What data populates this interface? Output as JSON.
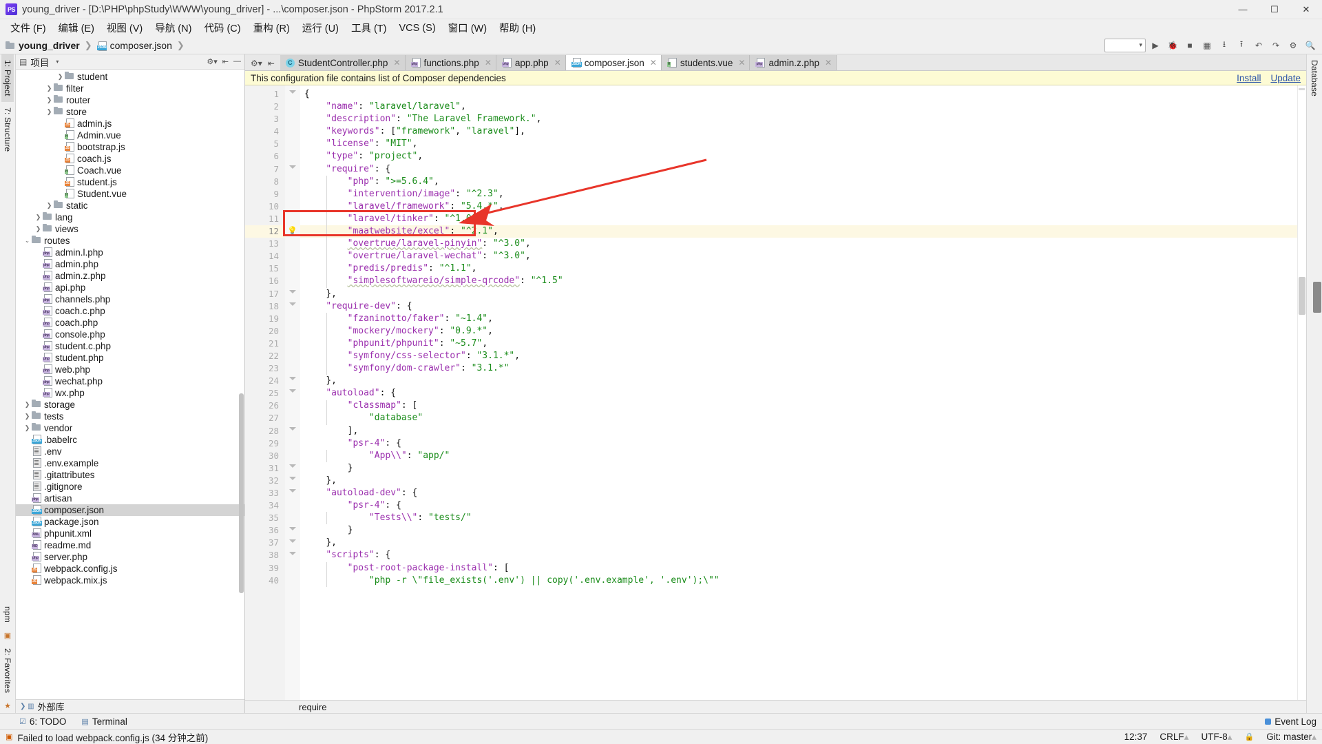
{
  "window": {
    "title": "young_driver - [D:\\PHP\\phpStudy\\WWW\\young_driver] - ...\\composer.json - PhpStorm 2017.2.1",
    "app_badge": "PS",
    "minimize": "—",
    "maximize": "☐",
    "close": "✕"
  },
  "menu": [
    {
      "label": "文件 (F)"
    },
    {
      "label": "编辑 (E)"
    },
    {
      "label": "视图 (V)"
    },
    {
      "label": "导航 (N)"
    },
    {
      "label": "代码 (C)"
    },
    {
      "label": "重构 (R)"
    },
    {
      "label": "运行 (U)"
    },
    {
      "label": "工具 (T)"
    },
    {
      "label": "VCS (S)"
    },
    {
      "label": "窗口 (W)"
    },
    {
      "label": "帮助 (H)"
    }
  ],
  "breadcrumb": {
    "project": "young_driver",
    "file": "composer.json",
    "sep": "❯"
  },
  "left_rail": {
    "project_tab": "1: Project",
    "structure_tab": "7: Structure",
    "npm_tab": "npm",
    "favorites_tab": "2: Favorites"
  },
  "right_rail": {
    "database_tab": "Database"
  },
  "project_panel": {
    "title": "项目",
    "caret": "▾",
    "external_libs": "外部库"
  },
  "tree": [
    {
      "depth": 3,
      "twisty": "❯",
      "icon": "folder",
      "label": "student"
    },
    {
      "depth": 2,
      "twisty": "❯",
      "icon": "folder",
      "label": "filter"
    },
    {
      "depth": 2,
      "twisty": "❯",
      "icon": "folder",
      "label": "router"
    },
    {
      "depth": 2,
      "twisty": "❯",
      "icon": "folder",
      "label": "store"
    },
    {
      "depth": 3,
      "twisty": "",
      "icon": "js",
      "label": "admin.js"
    },
    {
      "depth": 3,
      "twisty": "",
      "icon": "h",
      "label": "Admin.vue"
    },
    {
      "depth": 3,
      "twisty": "",
      "icon": "js",
      "label": "bootstrap.js"
    },
    {
      "depth": 3,
      "twisty": "",
      "icon": "js",
      "label": "coach.js"
    },
    {
      "depth": 3,
      "twisty": "",
      "icon": "h",
      "label": "Coach.vue"
    },
    {
      "depth": 3,
      "twisty": "",
      "icon": "js",
      "label": "student.js"
    },
    {
      "depth": 3,
      "twisty": "",
      "icon": "h",
      "label": "Student.vue"
    },
    {
      "depth": 2,
      "twisty": "❯",
      "icon": "folder",
      "label": "static"
    },
    {
      "depth": 1,
      "twisty": "❯",
      "icon": "folder",
      "label": "lang"
    },
    {
      "depth": 1,
      "twisty": "❯",
      "icon": "folder",
      "label": "views"
    },
    {
      "depth": 0,
      "twisty": "⌄",
      "icon": "folder",
      "label": "routes"
    },
    {
      "depth": 1,
      "twisty": "",
      "icon": "php",
      "label": "admin.l.php"
    },
    {
      "depth": 1,
      "twisty": "",
      "icon": "php",
      "label": "admin.php"
    },
    {
      "depth": 1,
      "twisty": "",
      "icon": "php",
      "label": "admin.z.php"
    },
    {
      "depth": 1,
      "twisty": "",
      "icon": "php",
      "label": "api.php"
    },
    {
      "depth": 1,
      "twisty": "",
      "icon": "php",
      "label": "channels.php"
    },
    {
      "depth": 1,
      "twisty": "",
      "icon": "php",
      "label": "coach.c.php"
    },
    {
      "depth": 1,
      "twisty": "",
      "icon": "php",
      "label": "coach.php"
    },
    {
      "depth": 1,
      "twisty": "",
      "icon": "php",
      "label": "console.php"
    },
    {
      "depth": 1,
      "twisty": "",
      "icon": "php",
      "label": "student.c.php"
    },
    {
      "depth": 1,
      "twisty": "",
      "icon": "php",
      "label": "student.php"
    },
    {
      "depth": 1,
      "twisty": "",
      "icon": "php",
      "label": "web.php"
    },
    {
      "depth": 1,
      "twisty": "",
      "icon": "php",
      "label": "wechat.php"
    },
    {
      "depth": 1,
      "twisty": "",
      "icon": "php",
      "label": "wx.php"
    },
    {
      "depth": 0,
      "twisty": "❯",
      "icon": "folder",
      "label": "storage"
    },
    {
      "depth": 0,
      "twisty": "❯",
      "icon": "folder",
      "label": "tests"
    },
    {
      "depth": 0,
      "twisty": "❯",
      "icon": "folder",
      "label": "vendor"
    },
    {
      "depth": 0,
      "twisty": "",
      "icon": "json",
      "label": ".babelrc"
    },
    {
      "depth": 0,
      "twisty": "",
      "icon": "txt",
      "label": ".env"
    },
    {
      "depth": 0,
      "twisty": "",
      "icon": "txt",
      "label": ".env.example"
    },
    {
      "depth": 0,
      "twisty": "",
      "icon": "txt",
      "label": ".gitattributes"
    },
    {
      "depth": 0,
      "twisty": "",
      "icon": "txt",
      "label": ".gitignore"
    },
    {
      "depth": 0,
      "twisty": "",
      "icon": "php",
      "label": "artisan"
    },
    {
      "depth": 0,
      "twisty": "",
      "icon": "json",
      "label": "composer.json",
      "selected": true
    },
    {
      "depth": 0,
      "twisty": "",
      "icon": "json",
      "label": "package.json"
    },
    {
      "depth": 0,
      "twisty": "",
      "icon": "xml",
      "label": "phpunit.xml"
    },
    {
      "depth": 0,
      "twisty": "",
      "icon": "md",
      "label": "readme.md"
    },
    {
      "depth": 0,
      "twisty": "",
      "icon": "php",
      "label": "server.php"
    },
    {
      "depth": 0,
      "twisty": "",
      "icon": "js",
      "label": "webpack.config.js"
    },
    {
      "depth": 0,
      "twisty": "",
      "icon": "js",
      "label": "webpack.mix.js"
    }
  ],
  "tabs": [
    {
      "label": "StudentController.php",
      "icon": "cls",
      "active": false
    },
    {
      "label": "functions.php",
      "icon": "php",
      "active": false
    },
    {
      "label": "app.php",
      "icon": "php",
      "active": false
    },
    {
      "label": "composer.json",
      "icon": "json",
      "active": true
    },
    {
      "label": "students.vue",
      "icon": "h",
      "active": false
    },
    {
      "label": "admin.z.php",
      "icon": "php",
      "active": false
    }
  ],
  "notification": {
    "message": "This configuration file contains list of Composer dependencies",
    "install": "Install",
    "update": "Update",
    "close": "✕"
  },
  "code": {
    "language": "json",
    "highlighted_line": 12,
    "lines": [
      {
        "n": 1,
        "indent": 0,
        "tokens": [
          {
            "t": "p",
            "v": "{"
          }
        ]
      },
      {
        "n": 2,
        "indent": 1,
        "tokens": [
          {
            "t": "k",
            "v": "\"name\""
          },
          {
            "t": "p",
            "v": ": "
          },
          {
            "t": "s",
            "v": "\"laravel/laravel\""
          },
          {
            "t": "p",
            "v": ","
          }
        ]
      },
      {
        "n": 3,
        "indent": 1,
        "tokens": [
          {
            "t": "k",
            "v": "\"description\""
          },
          {
            "t": "p",
            "v": ": "
          },
          {
            "t": "s",
            "v": "\"The Laravel Framework.\""
          },
          {
            "t": "p",
            "v": ","
          }
        ]
      },
      {
        "n": 4,
        "indent": 1,
        "tokens": [
          {
            "t": "k",
            "v": "\"keywords\""
          },
          {
            "t": "p",
            "v": ": ["
          },
          {
            "t": "s",
            "v": "\"framework\""
          },
          {
            "t": "p",
            "v": ", "
          },
          {
            "t": "s",
            "v": "\"laravel\""
          },
          {
            "t": "p",
            "v": "],"
          }
        ]
      },
      {
        "n": 5,
        "indent": 1,
        "tokens": [
          {
            "t": "k",
            "v": "\"license\""
          },
          {
            "t": "p",
            "v": ": "
          },
          {
            "t": "s",
            "v": "\"MIT\""
          },
          {
            "t": "p",
            "v": ","
          }
        ]
      },
      {
        "n": 6,
        "indent": 1,
        "tokens": [
          {
            "t": "k",
            "v": "\"type\""
          },
          {
            "t": "p",
            "v": ": "
          },
          {
            "t": "s",
            "v": "\"project\""
          },
          {
            "t": "p",
            "v": ","
          }
        ]
      },
      {
        "n": 7,
        "indent": 1,
        "tokens": [
          {
            "t": "k",
            "v": "\"require\""
          },
          {
            "t": "p",
            "v": ": {"
          }
        ]
      },
      {
        "n": 8,
        "indent": 2,
        "tokens": [
          {
            "t": "k",
            "v": "\"php\""
          },
          {
            "t": "p",
            "v": ": "
          },
          {
            "t": "s",
            "v": "\">=5.6.4\""
          },
          {
            "t": "p",
            "v": ","
          }
        ]
      },
      {
        "n": 9,
        "indent": 2,
        "tokens": [
          {
            "t": "k",
            "v": "\"intervention/image\""
          },
          {
            "t": "p",
            "v": ": "
          },
          {
            "t": "s",
            "v": "\"^2.3\""
          },
          {
            "t": "p",
            "v": ","
          }
        ]
      },
      {
        "n": 10,
        "indent": 2,
        "tokens": [
          {
            "t": "k",
            "v": "\"laravel/framework\""
          },
          {
            "t": "p",
            "v": ": "
          },
          {
            "t": "s",
            "v": "\"5.4.*\""
          },
          {
            "t": "p",
            "v": ","
          }
        ]
      },
      {
        "n": 11,
        "indent": 2,
        "tokens": [
          {
            "t": "k",
            "v": "\"laravel/tinker\""
          },
          {
            "t": "p",
            "v": ": "
          },
          {
            "t": "s",
            "v": "\"^1.0\""
          },
          {
            "t": "p",
            "v": ","
          }
        ]
      },
      {
        "n": 12,
        "indent": 2,
        "tokens": [
          {
            "t": "k",
            "v": "\"maatwebsite/excel\""
          },
          {
            "t": "p",
            "v": ": "
          },
          {
            "t": "s",
            "v": "\"^2.1\""
          },
          {
            "t": "p",
            "v": ","
          }
        ]
      },
      {
        "n": 13,
        "indent": 2,
        "tokens": [
          {
            "t": "k",
            "v": "\"overtrue/laravel-pinyin\""
          },
          {
            "t": "p",
            "v": ": "
          },
          {
            "t": "s",
            "v": "\"^3.0\""
          },
          {
            "t": "p",
            "v": ","
          }
        ]
      },
      {
        "n": 14,
        "indent": 2,
        "tokens": [
          {
            "t": "k",
            "v": "\"overtrue/laravel-wechat\""
          },
          {
            "t": "p",
            "v": ": "
          },
          {
            "t": "s",
            "v": "\"^3.0\""
          },
          {
            "t": "p",
            "v": ","
          }
        ]
      },
      {
        "n": 15,
        "indent": 2,
        "tokens": [
          {
            "t": "k",
            "v": "\"predis/predis\""
          },
          {
            "t": "p",
            "v": ": "
          },
          {
            "t": "s",
            "v": "\"^1.1\""
          },
          {
            "t": "p",
            "v": ","
          }
        ]
      },
      {
        "n": 16,
        "indent": 2,
        "tokens": [
          {
            "t": "k",
            "v": "\"simplesoftwareio/simple-qrcode\""
          },
          {
            "t": "p",
            "v": ": "
          },
          {
            "t": "s",
            "v": "\"^1.5\""
          }
        ]
      },
      {
        "n": 17,
        "indent": 1,
        "tokens": [
          {
            "t": "p",
            "v": "},"
          }
        ]
      },
      {
        "n": 18,
        "indent": 1,
        "tokens": [
          {
            "t": "k",
            "v": "\"require-dev\""
          },
          {
            "t": "p",
            "v": ": {"
          }
        ]
      },
      {
        "n": 19,
        "indent": 2,
        "tokens": [
          {
            "t": "k",
            "v": "\"fzaninotto/faker\""
          },
          {
            "t": "p",
            "v": ": "
          },
          {
            "t": "s",
            "v": "\"~1.4\""
          },
          {
            "t": "p",
            "v": ","
          }
        ]
      },
      {
        "n": 20,
        "indent": 2,
        "tokens": [
          {
            "t": "k",
            "v": "\"mockery/mockery\""
          },
          {
            "t": "p",
            "v": ": "
          },
          {
            "t": "s",
            "v": "\"0.9.*\""
          },
          {
            "t": "p",
            "v": ","
          }
        ]
      },
      {
        "n": 21,
        "indent": 2,
        "tokens": [
          {
            "t": "k",
            "v": "\"phpunit/phpunit\""
          },
          {
            "t": "p",
            "v": ": "
          },
          {
            "t": "s",
            "v": "\"~5.7\""
          },
          {
            "t": "p",
            "v": ","
          }
        ]
      },
      {
        "n": 22,
        "indent": 2,
        "tokens": [
          {
            "t": "k",
            "v": "\"symfony/css-selector\""
          },
          {
            "t": "p",
            "v": ": "
          },
          {
            "t": "s",
            "v": "\"3.1.*\""
          },
          {
            "t": "p",
            "v": ","
          }
        ]
      },
      {
        "n": 23,
        "indent": 2,
        "tokens": [
          {
            "t": "k",
            "v": "\"symfony/dom-crawler\""
          },
          {
            "t": "p",
            "v": ": "
          },
          {
            "t": "s",
            "v": "\"3.1.*\""
          }
        ]
      },
      {
        "n": 24,
        "indent": 1,
        "tokens": [
          {
            "t": "p",
            "v": "},"
          }
        ]
      },
      {
        "n": 25,
        "indent": 1,
        "tokens": [
          {
            "t": "k",
            "v": "\"autoload\""
          },
          {
            "t": "p",
            "v": ": {"
          }
        ]
      },
      {
        "n": 26,
        "indent": 2,
        "tokens": [
          {
            "t": "k",
            "v": "\"classmap\""
          },
          {
            "t": "p",
            "v": ": ["
          }
        ]
      },
      {
        "n": 27,
        "indent": 3,
        "tokens": [
          {
            "t": "s",
            "v": "\"database\""
          }
        ]
      },
      {
        "n": 28,
        "indent": 2,
        "tokens": [
          {
            "t": "p",
            "v": "],"
          }
        ]
      },
      {
        "n": 29,
        "indent": 2,
        "tokens": [
          {
            "t": "k",
            "v": "\"psr-4\""
          },
          {
            "t": "p",
            "v": ": {"
          }
        ]
      },
      {
        "n": 30,
        "indent": 3,
        "tokens": [
          {
            "t": "k",
            "v": "\"App\\\\\""
          },
          {
            "t": "p",
            "v": ": "
          },
          {
            "t": "s",
            "v": "\"app/\""
          }
        ]
      },
      {
        "n": 31,
        "indent": 2,
        "tokens": [
          {
            "t": "p",
            "v": "}"
          }
        ]
      },
      {
        "n": 32,
        "indent": 1,
        "tokens": [
          {
            "t": "p",
            "v": "},"
          }
        ]
      },
      {
        "n": 33,
        "indent": 1,
        "tokens": [
          {
            "t": "k",
            "v": "\"autoload-dev\""
          },
          {
            "t": "p",
            "v": ": {"
          }
        ]
      },
      {
        "n": 34,
        "indent": 2,
        "tokens": [
          {
            "t": "k",
            "v": "\"psr-4\""
          },
          {
            "t": "p",
            "v": ": {"
          }
        ]
      },
      {
        "n": 35,
        "indent": 3,
        "tokens": [
          {
            "t": "k",
            "v": "\"Tests\\\\\""
          },
          {
            "t": "p",
            "v": ": "
          },
          {
            "t": "s",
            "v": "\"tests/\""
          }
        ]
      },
      {
        "n": 36,
        "indent": 2,
        "tokens": [
          {
            "t": "p",
            "v": "}"
          }
        ]
      },
      {
        "n": 37,
        "indent": 1,
        "tokens": [
          {
            "t": "p",
            "v": "},"
          }
        ]
      },
      {
        "n": 38,
        "indent": 1,
        "tokens": [
          {
            "t": "k",
            "v": "\"scripts\""
          },
          {
            "t": "p",
            "v": ": {"
          }
        ]
      },
      {
        "n": 39,
        "indent": 2,
        "tokens": [
          {
            "t": "k",
            "v": "\"post-root-package-install\""
          },
          {
            "t": "p",
            "v": ": ["
          }
        ]
      },
      {
        "n": 40,
        "indent": 3,
        "tokens": [
          {
            "t": "s",
            "v": "\"php -r \\\"file_exists('.env') || copy('.env.example', '.env');\\\"\""
          }
        ]
      }
    ]
  },
  "annotation": {
    "color": "#e8352a",
    "target_line": 12,
    "bulb_icon": "💡"
  },
  "editor_status": {
    "scope": "require"
  },
  "bottom_toolwindows": [
    {
      "label": "6: TODO",
      "icon": "todo-icon"
    },
    {
      "label": "Terminal",
      "icon": "terminal-icon"
    }
  ],
  "event_log": {
    "label": "Event Log"
  },
  "statusbar": {
    "message": "Failed to load webpack.config.js (34 分钟之前)",
    "time": "12:37",
    "line_sep": "CRLF",
    "encoding": "UTF-8",
    "branch": "Git: master",
    "branch_caret": "▴",
    "sep_caret": "▴",
    "enc_caret": "▴",
    "lock": "🔒"
  }
}
